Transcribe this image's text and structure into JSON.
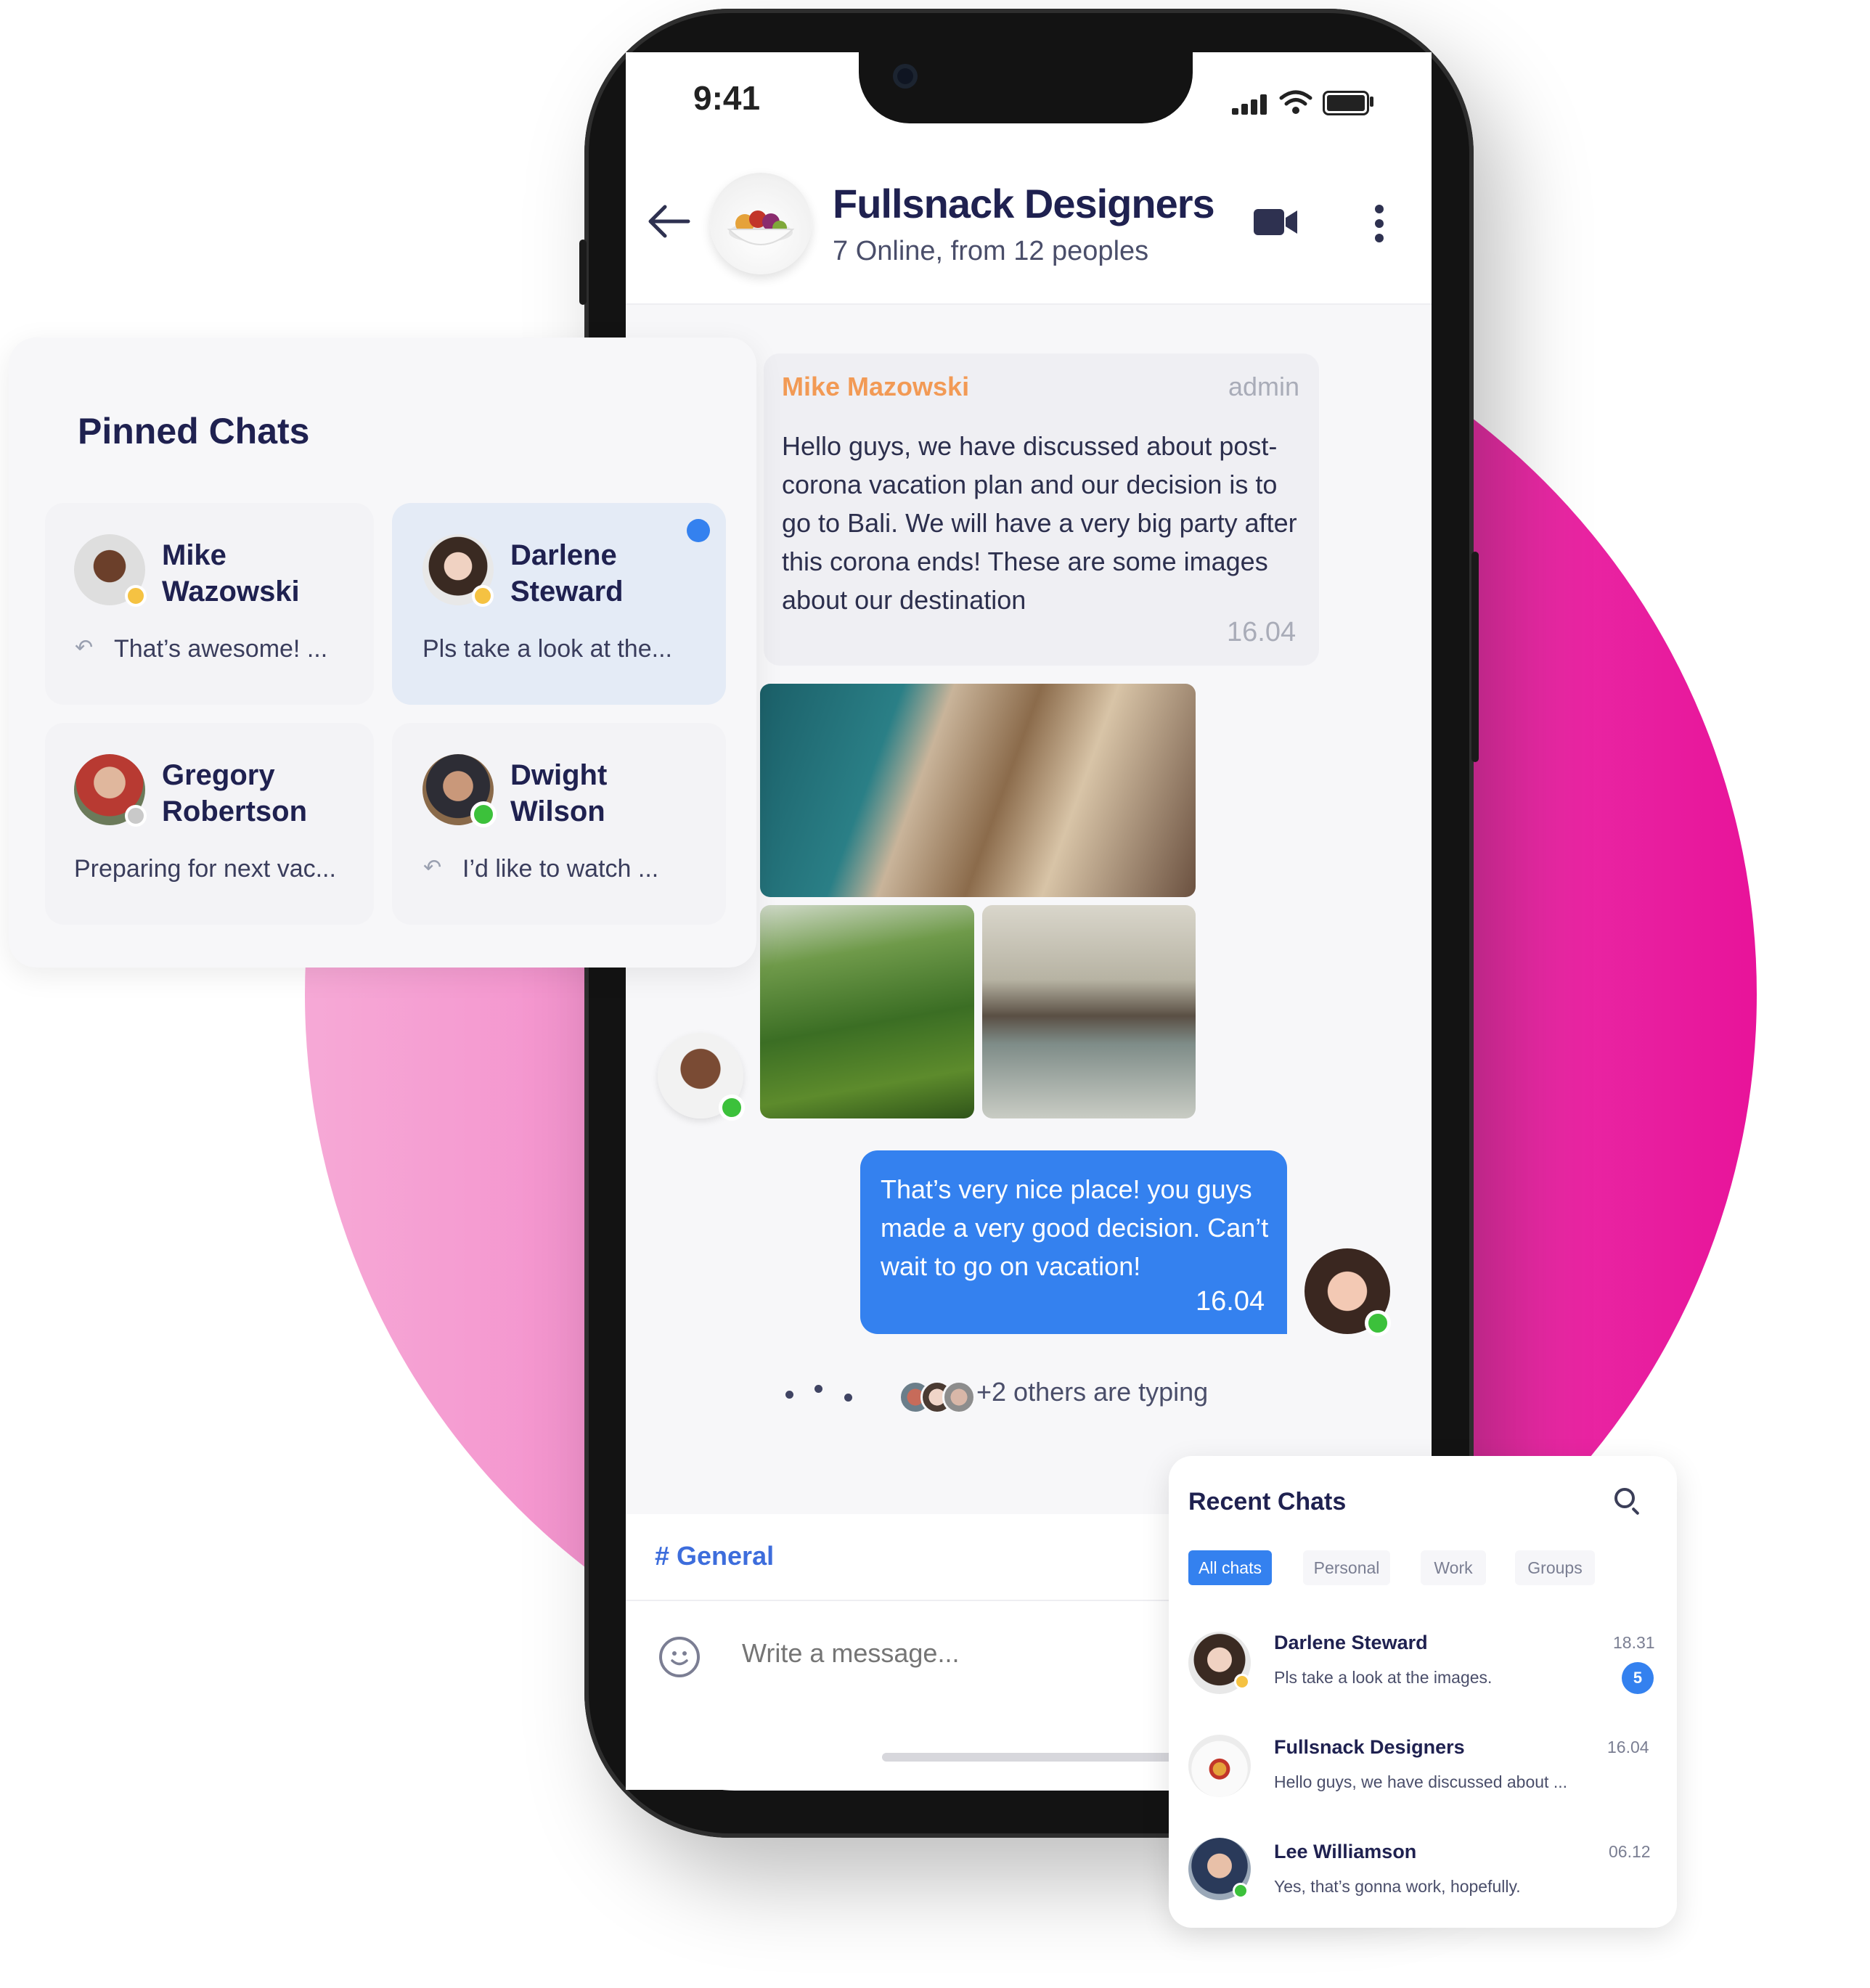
{
  "status_bar": {
    "time": "9:41"
  },
  "chat_header": {
    "title": "Fullsnack Designers",
    "subtitle": "7 Online, from 12 peoples"
  },
  "messages": [
    {
      "sender": "Mike Mazowski",
      "role": "admin",
      "text": "Hello guys, we have discussed about post-corona vacation plan and our decision is to go to Bali. We will have a very big party after this corona ends! These are some images about our destination",
      "time": "16.04"
    },
    {
      "text": "That’s very nice place! you guys made a very good decision. Can’t wait to go on vacation!",
      "time": "16.04"
    }
  ],
  "typing": {
    "text": "+2 others are typing"
  },
  "channel": {
    "name": "# General"
  },
  "composer": {
    "placeholder": "Write a message..."
  },
  "pinned": {
    "title": "Pinned Chats",
    "items": [
      {
        "first": "Mike",
        "last": "Wazowski",
        "preview": "That’s awesome! ...",
        "status": "away"
      },
      {
        "first": "Darlene",
        "last": "Steward",
        "preview": "Pls take a look at the...",
        "status": "away"
      },
      {
        "first": "Gregory",
        "last": "Robertson",
        "preview": "Preparing for next vac...",
        "status": "offline"
      },
      {
        "first": "Dwight",
        "last": "Wilson",
        "preview": "I’d like to watch ...",
        "status": "online"
      }
    ]
  },
  "recent": {
    "title": "Recent Chats",
    "tabs": [
      "All chats",
      "Personal",
      "Work",
      "Groups"
    ],
    "items": [
      {
        "name": "Darlene Steward",
        "preview": "Pls take a look at the images.",
        "time": "18.31",
        "unread": "5"
      },
      {
        "name": "Fullsnack Designers",
        "preview": "Hello guys, we have discussed about ...",
        "time": "16.04"
      },
      {
        "name": "Lee Williamson",
        "preview": "Yes, that’s gonna work, hopefully.",
        "time": "06.12"
      }
    ]
  },
  "colors": {
    "accent": "#3481ef",
    "sender_orange": "#f29a55",
    "online": "#3cc13b",
    "away": "#f5c242",
    "pink": "#e8139a"
  }
}
